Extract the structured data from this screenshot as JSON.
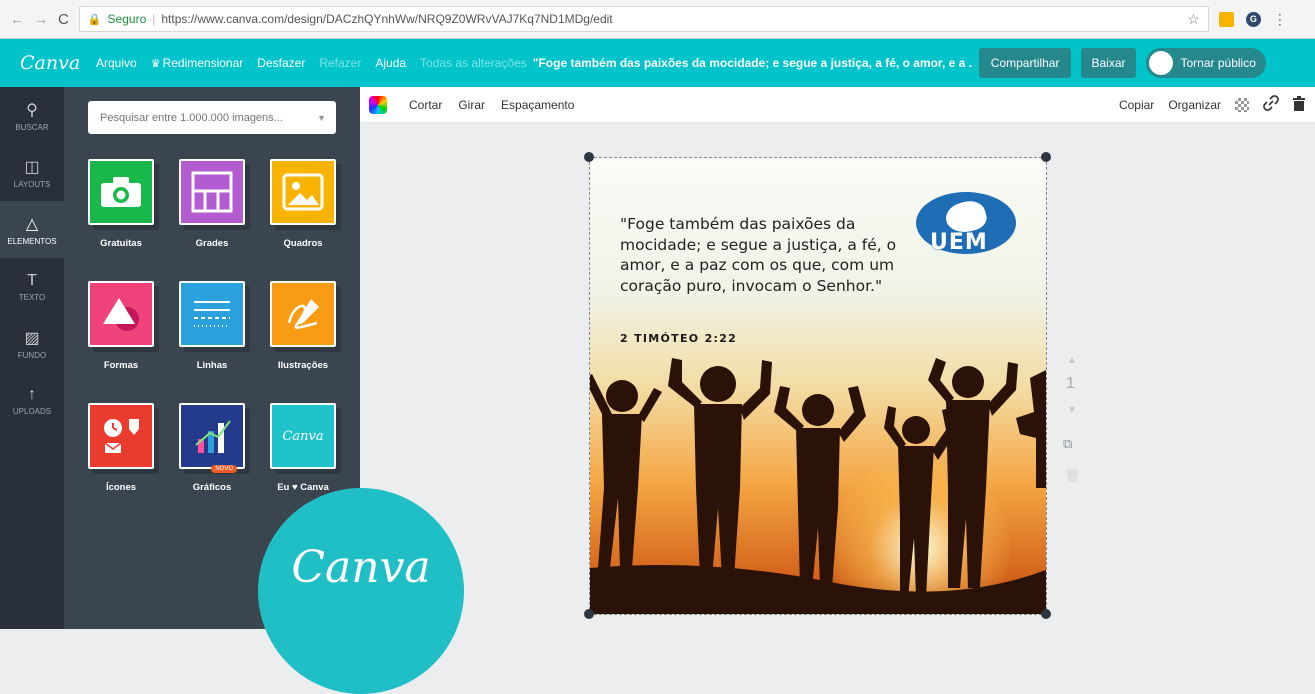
{
  "browser": {
    "security_label": "Seguro",
    "url": "https://www.canva.com/design/DACzhQYnhWw/NRQ9Z0WRvVAJ7Kq7ND1MDg/edit"
  },
  "topbar": {
    "logo": "Canva",
    "menu": {
      "file": "Arquivo",
      "resize": "Redimensionar",
      "undo": "Desfazer",
      "redo": "Refazer",
      "help": "Ajuda",
      "saved": "Todas as alterações"
    },
    "doc_title": "\"Foge também das paixões da mocidade; e segue a justiça, a fé, o amor, e a ...",
    "share": "Compartilhar",
    "download": "Baixar",
    "make_public": "Tornar público"
  },
  "rail": [
    {
      "icon": "search-icon",
      "glyph": "⚲",
      "label": "BUSCAR"
    },
    {
      "icon": "layouts-icon",
      "glyph": "◫",
      "label": "LAYOUTS"
    },
    {
      "icon": "elements-icon",
      "glyph": "△",
      "label": "ELEMENTOS"
    },
    {
      "icon": "text-icon",
      "glyph": "T",
      "label": "TEXTO"
    },
    {
      "icon": "background-icon",
      "glyph": "▨",
      "label": "FUNDO"
    },
    {
      "icon": "upload-icon",
      "glyph": "↑",
      "label": "UPLOADS"
    }
  ],
  "panel": {
    "search_placeholder": "Pesquisar entre 1.000.000 imagens...",
    "tiles": [
      {
        "label": "Gratuitas",
        "color": "#18b94a"
      },
      {
        "label": "Grades",
        "color": "#b35bd1"
      },
      {
        "label": "Quadros",
        "color": "#f8b400"
      },
      {
        "label": "Formas",
        "color": "#f0427a"
      },
      {
        "label": "Linhas",
        "color": "#2aa0dd"
      },
      {
        "label": "Ilustrações",
        "color": "#f99b13"
      },
      {
        "label": "Ícones",
        "color": "#e93c2f"
      },
      {
        "label": "Gráficos",
        "color": "#233b8a",
        "badge": "NOVO"
      },
      {
        "label": "Eu ♥ Canva",
        "color": "#20c3c9",
        "mini_logo": "Canva"
      }
    ]
  },
  "editor_toolbar": {
    "crop": "Cortar",
    "flip": "Girar",
    "spacing": "Espaçamento",
    "copy": "Copiar",
    "arrange": "Organizar"
  },
  "design": {
    "quote": "\"Foge também das paixões da mocidade; e segue a justiça, a fé, o amor, e a paz com os que, com um coração puro, invocam o Senhor.\"",
    "reference": "2 TIMÓTEO 2:22",
    "logo_text": "UEM"
  },
  "page": {
    "number": "1"
  },
  "badge": {
    "text": "Canva"
  },
  "colors": {
    "brand": "#01c4cb",
    "sidebar": "#293039",
    "panel": "#3a4550"
  }
}
